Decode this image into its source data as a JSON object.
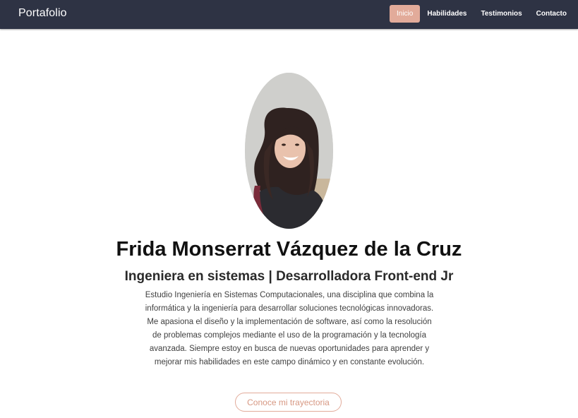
{
  "navbar": {
    "brand": "Portafolio",
    "links": [
      {
        "label": "Inicio",
        "active": true
      },
      {
        "label": "Habilidades",
        "active": false
      },
      {
        "label": "Testimonios",
        "active": false
      },
      {
        "label": "Contacto",
        "active": false
      }
    ]
  },
  "hero": {
    "name": "Frida Monserrat Vázquez de la Cruz",
    "role": "Ingeniera en sistemas | Desarrolladora Front-end Jr",
    "bio": "Estudio Ingeniería en Sistemas Computacionales, una disciplina que combina la informática y la ingeniería para desarrollar soluciones tecnológicas innovadoras. Me apasiona el diseño y la implementación de software, así como la resolución de problemas complejos mediante el uso de la programación y la tecnología avanzada. Siempre estoy en busca de nuevas oportunidades para aprender y mejorar mis habilidades en este campo dinámico y en constante evolución.",
    "cta_label": "Conoce mi trayectoria"
  },
  "colors": {
    "navbar_bg": "#2e3344",
    "accent": "#e2ab9a"
  }
}
